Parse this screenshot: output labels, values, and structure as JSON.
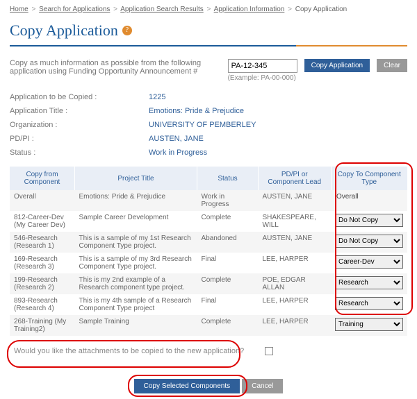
{
  "breadcrumb": {
    "items": [
      "Home",
      "Search for Applications",
      "Application Search Results",
      "Application Information"
    ],
    "current": "Copy Application"
  },
  "title": "Copy Application",
  "copy_prompt": "Copy as much information as possible from the following application using Funding Opportunity Announcement #",
  "foa_value": "PA-12-345",
  "copy_button": "Copy Application",
  "clear_button": "Clear",
  "example_text": "(Example: PA-00-000)",
  "info": {
    "app_copied_label": "Application to be Copied :",
    "app_copied_value": "1225",
    "app_title_label": "Application Title :",
    "app_title_value": "Emotions: Pride & Prejudice",
    "org_label": "Organization :",
    "org_value": "UNIVERSITY OF PEMBERLEY",
    "pdpi_label": "PD/PI :",
    "pdpi_value": "AUSTEN, JANE",
    "status_label": "Status :",
    "status_value": "Work in Progress"
  },
  "table": {
    "headers": {
      "c1": "Copy from Component",
      "c2": "Project Title",
      "c3": "Status",
      "c4": "PD/PI or Component Lead",
      "c5": "Copy To Component Type"
    },
    "rows": [
      {
        "c1": "Overall",
        "c2": "Emotions: Pride & Prejudice",
        "c3": "Work in Progress",
        "c4": "AUSTEN, JANE",
        "c5_type": "text",
        "c5_value": "Overall"
      },
      {
        "c1": "812-Career-Dev (My Career Dev)",
        "c2": "Sample Career Development",
        "c3": "Complete",
        "c4": "SHAKESPEARE, WILL",
        "c5_type": "select",
        "c5_value": "Do Not Copy"
      },
      {
        "c1": "546-Research (Research 1)",
        "c2": "This is a sample of my 1st Research Component Type project.",
        "c3": "Abandoned",
        "c4": "AUSTEN, JANE",
        "c5_type": "select",
        "c5_value": "Do Not Copy"
      },
      {
        "c1": "169-Research (Research 3)",
        "c2": "This is a sample of my 3rd Research Component Type project.",
        "c3": "Final",
        "c4": "LEE, HARPER",
        "c5_type": "select",
        "c5_value": "Career-Dev"
      },
      {
        "c1": "199-Research (Research 2)",
        "c2": "This is my 2nd example of a Research component type project.",
        "c3": "Complete",
        "c4": "POE, EDGAR ALLAN",
        "c5_type": "select",
        "c5_value": "Research"
      },
      {
        "c1": "893-Research (Research 4)",
        "c2": "This is my 4th sample of a Research Component Type project",
        "c3": "Final",
        "c4": "LEE, HARPER",
        "c5_type": "select",
        "c5_value": "Research"
      },
      {
        "c1": "268-Training (My Training2)",
        "c2": "Sample Training",
        "c3": "Complete",
        "c4": "LEE, HARPER",
        "c5_type": "select",
        "c5_value": "Training"
      }
    ]
  },
  "attach_prompt": "Would you like the attachments to be copied to the new application?",
  "actions": {
    "copy_selected": "Copy Selected Components",
    "cancel": "Cancel"
  }
}
